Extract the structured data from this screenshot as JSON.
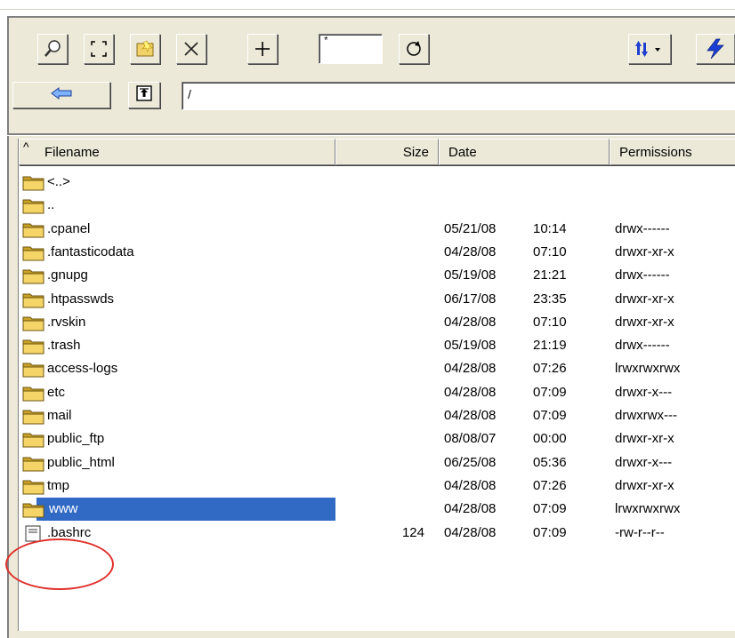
{
  "toolbar": {
    "mask_value": "*",
    "buttons": [
      {
        "name": "find-icon"
      },
      {
        "name": "select-region-icon"
      },
      {
        "name": "new-folder-icon"
      },
      {
        "name": "delete-icon"
      },
      {
        "name": "add-icon"
      }
    ],
    "refresh_icon": "refresh-icon",
    "sort_icon": "sort-icon",
    "connect_icon": "lightning-icon"
  },
  "navigation": {
    "back_icon": "back-arrow-icon",
    "up_icon": "parent-folder-icon",
    "path": "/"
  },
  "columns": {
    "sort_indicator": "^",
    "filename": "Filename",
    "size": "Size",
    "date": "Date",
    "permissions": "Permissions"
  },
  "files": [
    {
      "name": "<..>",
      "size": "",
      "date": "",
      "time": "",
      "perm": "",
      "type": "folder"
    },
    {
      "name": "..",
      "size": "",
      "date": "",
      "time": "",
      "perm": "",
      "type": "folder"
    },
    {
      "name": ".cpanel",
      "size": "",
      "date": "05/21/08",
      "time": "10:14",
      "perm": "drwx------",
      "type": "folder"
    },
    {
      "name": ".fantasticodata",
      "size": "",
      "date": "04/28/08",
      "time": "07:10",
      "perm": "drwxr-xr-x",
      "type": "folder"
    },
    {
      "name": ".gnupg",
      "size": "",
      "date": "05/19/08",
      "time": "21:21",
      "perm": "drwx------",
      "type": "folder"
    },
    {
      "name": ".htpasswds",
      "size": "",
      "date": "06/17/08",
      "time": "23:35",
      "perm": "drwxr-xr-x",
      "type": "folder"
    },
    {
      "name": ".rvskin",
      "size": "",
      "date": "04/28/08",
      "time": "07:10",
      "perm": "drwxr-xr-x",
      "type": "folder"
    },
    {
      "name": ".trash",
      "size": "",
      "date": "05/19/08",
      "time": "21:19",
      "perm": "drwx------",
      "type": "folder"
    },
    {
      "name": "access-logs",
      "size": "",
      "date": "04/28/08",
      "time": "07:26",
      "perm": "lrwxrwxrwx",
      "type": "folder"
    },
    {
      "name": "etc",
      "size": "",
      "date": "04/28/08",
      "time": "07:09",
      "perm": "drwxr-x---",
      "type": "folder"
    },
    {
      "name": "mail",
      "size": "",
      "date": "04/28/08",
      "time": "07:09",
      "perm": "drwxrwx---",
      "type": "folder"
    },
    {
      "name": "public_ftp",
      "size": "",
      "date": "08/08/07",
      "time": "00:00",
      "perm": "drwxr-xr-x",
      "type": "folder"
    },
    {
      "name": "public_html",
      "size": "",
      "date": "06/25/08",
      "time": "05:36",
      "perm": "drwxr-x---",
      "type": "folder"
    },
    {
      "name": "tmp",
      "size": "",
      "date": "04/28/08",
      "time": "07:26",
      "perm": "drwxr-xr-x",
      "type": "folder"
    },
    {
      "name": "www",
      "size": "",
      "date": "04/28/08",
      "time": "07:09",
      "perm": "lrwxrwxrwx",
      "type": "folder",
      "selected": true
    },
    {
      "name": ".bashrc",
      "size": "124",
      "date": "04/28/08",
      "time": "07:09",
      "perm": "-rw-r--r--",
      "type": "file"
    }
  ],
  "colors": {
    "selection": "#316ac5",
    "folder": "#f2c94c",
    "annotation": "#e0302a"
  }
}
